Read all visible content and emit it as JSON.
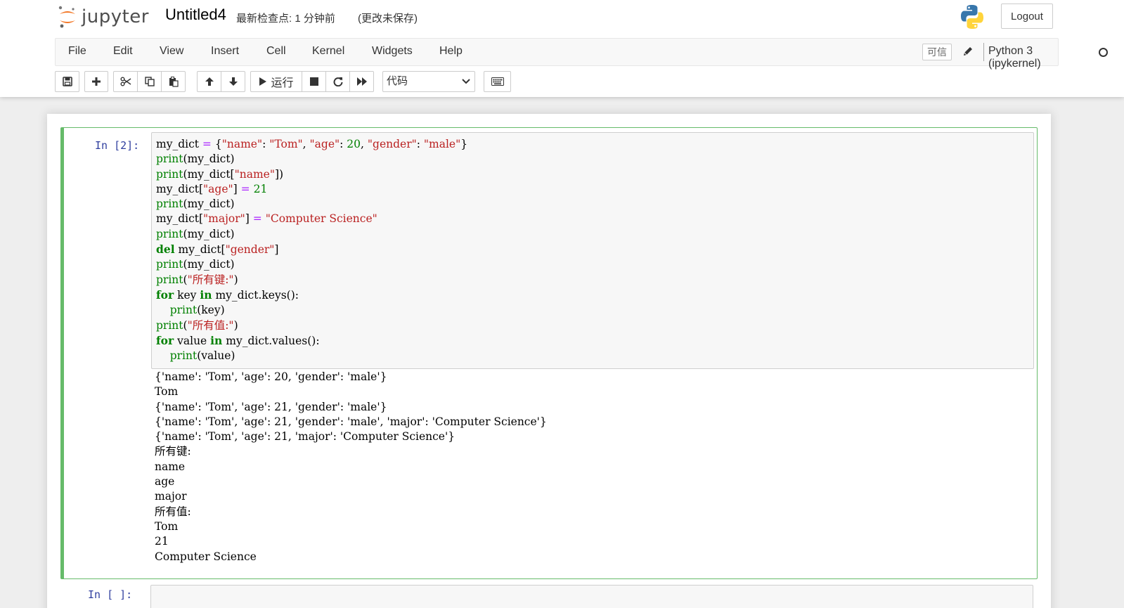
{
  "header": {
    "logo_text": "jupyter",
    "notebook_title": "Untitled4",
    "checkpoint": "最新检查点: 1 分钟前",
    "autosave": "(更改未保存)",
    "logout_label": "Logout"
  },
  "menubar": {
    "items": [
      "File",
      "Edit",
      "View",
      "Insert",
      "Cell",
      "Kernel",
      "Widgets",
      "Help"
    ],
    "trusted_label": "可信",
    "kernel_name": "Python 3 (ipykernel)"
  },
  "toolbar": {
    "run_label": "运行",
    "cell_type": "代码"
  },
  "cells": [
    {
      "prompt": "In  [2]:",
      "code_lines": [
        "my_dict = {\"name\": \"Tom\", \"age\": 20, \"gender\": \"male\"}",
        "print(my_dict)",
        "print(my_dict[\"name\"])",
        "my_dict[\"age\"] = 21",
        "print(my_dict)",
        "my_dict[\"major\"] = \"Computer Science\"",
        "print(my_dict)",
        "del my_dict[\"gender\"]",
        "print(my_dict)",
        "print(\"所有键:\")",
        "for key in my_dict.keys():",
        "    print(key)",
        "print(\"所有值:\")",
        "for value in my_dict.values():",
        "    print(value)"
      ],
      "output_lines": [
        "{'name': 'Tom', 'age': 20, 'gender': 'male'}",
        "Tom",
        "{'name': 'Tom', 'age': 21, 'gender': 'male'}",
        "{'name': 'Tom', 'age': 21, 'gender': 'male', 'major': 'Computer Science'}",
        "{'name': 'Tom', 'age': 21, 'major': 'Computer Science'}",
        "所有键:",
        "name",
        "age",
        "major",
        "所有值:",
        "Tom",
        "21",
        "Computer Science"
      ]
    },
    {
      "prompt": "In  [ ]:"
    }
  ],
  "colors": {
    "selected_border": "#66bb6a",
    "prompt": "#303f9f",
    "keyword": "#008000",
    "string": "#ba2121",
    "operator": "#aa22ff"
  }
}
